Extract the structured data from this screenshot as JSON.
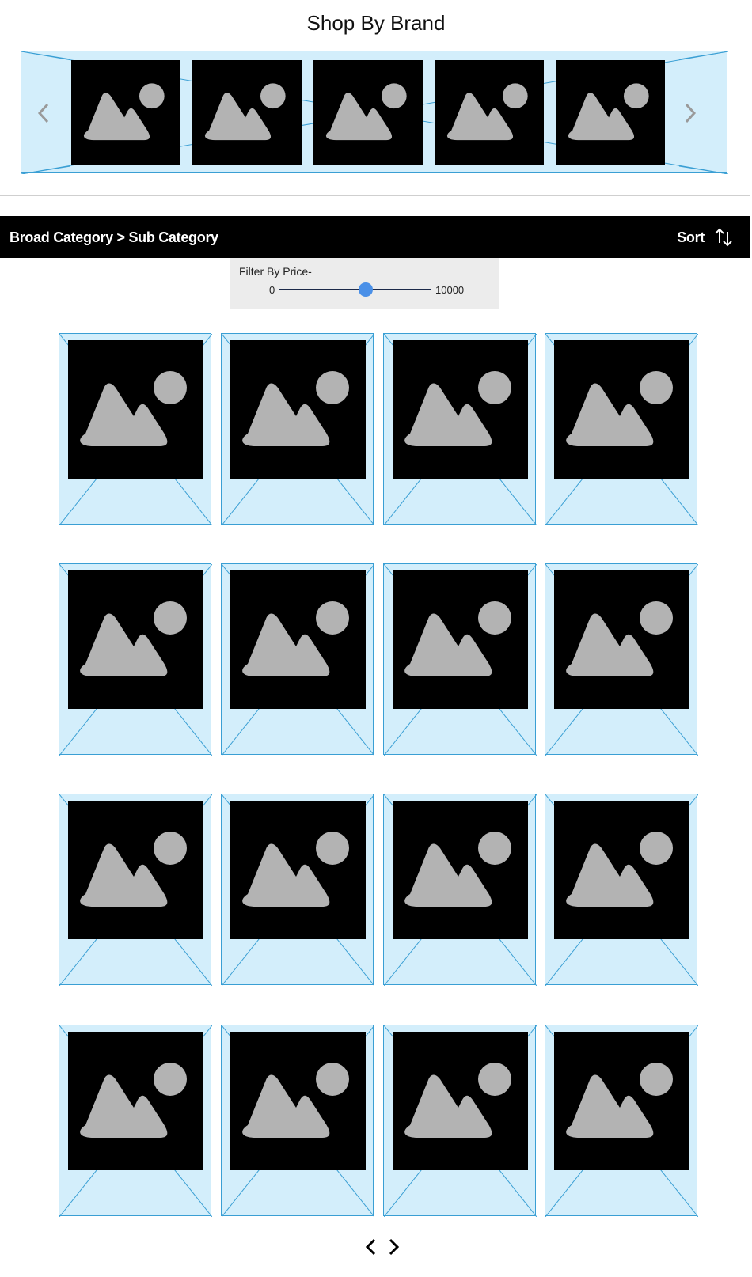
{
  "brands": {
    "title": "Shop By Brand",
    "prev_icon": "chevron-left-icon",
    "next_icon": "chevron-right-icon",
    "logo_count": 5
  },
  "category_bar": {
    "breadcrumb": "Broad Category > Sub Category",
    "sort_label": "Sort",
    "sort_icon": "sort-arrows-icon"
  },
  "filter": {
    "label": "Filter By Price-",
    "min": "0",
    "max": "10000",
    "value_fraction": 0.57
  },
  "products": {
    "rows": 4,
    "columns": 4,
    "image_icon": "image-placeholder-icon"
  },
  "pagination": {
    "prev_icon": "chevron-left-icon",
    "next_icon": "chevron-right-icon"
  },
  "colors": {
    "placeholder_bg": "#d3eefb",
    "placeholder_border": "#3a9fd4",
    "slider_thumb": "#4a90e8",
    "category_bar": "#000000"
  }
}
